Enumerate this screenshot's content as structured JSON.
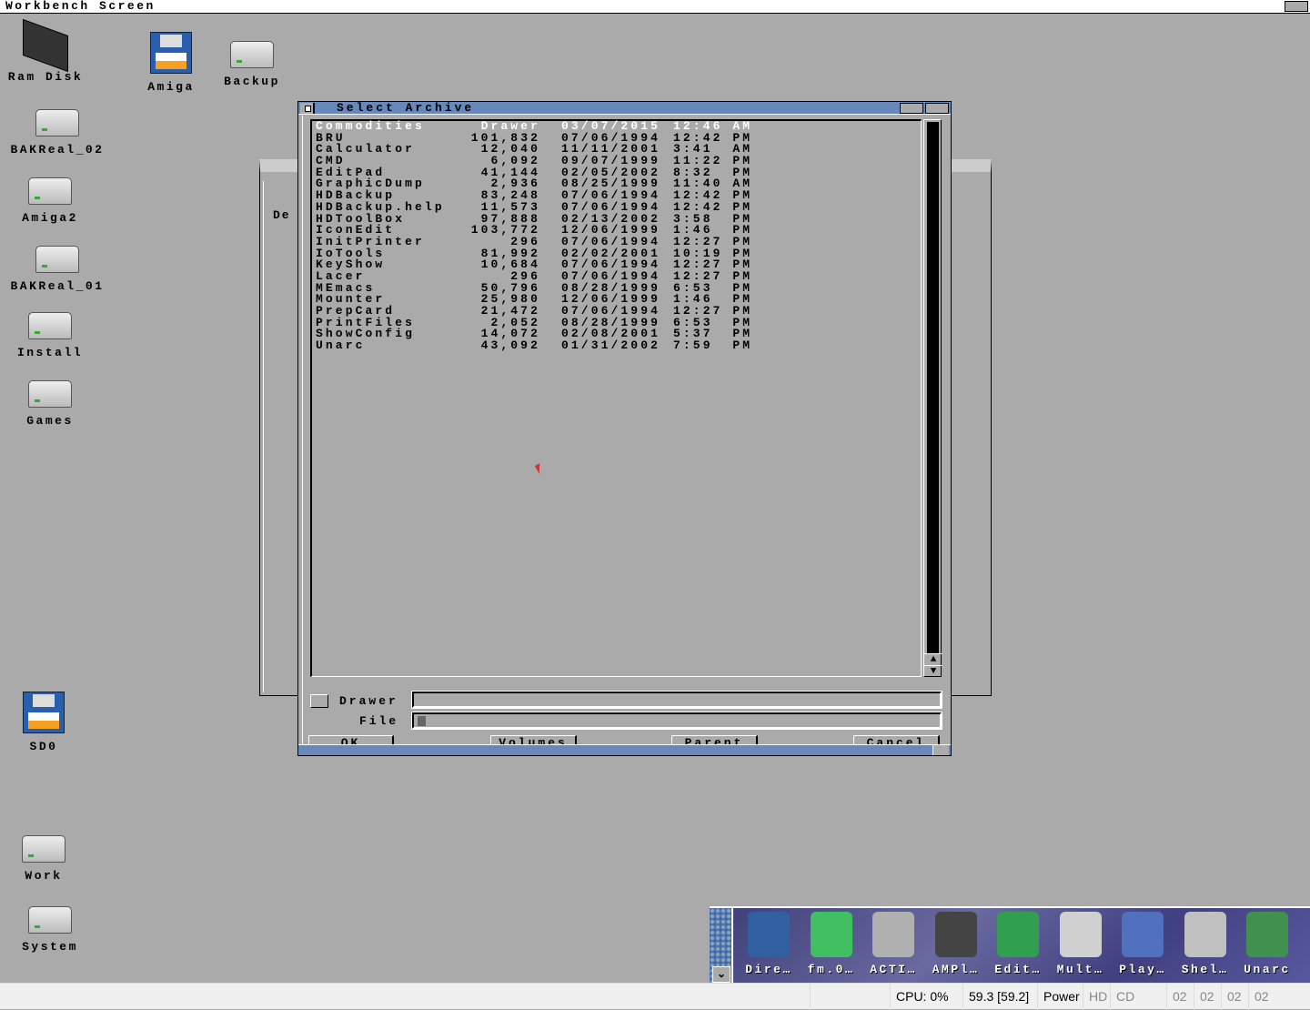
{
  "screen": {
    "title": "Workbench Screen"
  },
  "desktop_icons": [
    {
      "label": "Ram Disk",
      "icon": "ram-chip-icon"
    },
    {
      "label": "Amiga",
      "icon": "floppy-icon"
    },
    {
      "label": "Backup",
      "icon": "harddisk-icon"
    },
    {
      "label": "BAKReal_02",
      "icon": "harddisk-icon"
    },
    {
      "label": "Amiga2",
      "icon": "harddisk-icon"
    },
    {
      "label": "BAKReal_01",
      "icon": "harddisk-icon"
    },
    {
      "label": "Install",
      "icon": "harddisk-icon"
    },
    {
      "label": "Games",
      "icon": "harddisk-icon"
    },
    {
      "label": "SD0",
      "icon": "floppy-icon"
    },
    {
      "label": "Work",
      "icon": "harddisk-icon"
    },
    {
      "label": "System",
      "icon": "harddisk-icon"
    }
  ],
  "background_window": {
    "partial_label": "De"
  },
  "dialog": {
    "title": "Select Archive",
    "files": [
      {
        "name": "Commodities",
        "size": "Drawer",
        "date": "03/07/2015",
        "time": "12:46 AM",
        "selected": true
      },
      {
        "name": "BRU",
        "size": "101,832",
        "date": "07/06/1994",
        "time": "12:42 PM"
      },
      {
        "name": "Calculator",
        "size": "12,040",
        "date": "11/11/2001",
        "time": "3:41  AM"
      },
      {
        "name": "CMD",
        "size": "6,092",
        "date": "09/07/1999",
        "time": "11:22 PM"
      },
      {
        "name": "EditPad",
        "size": "41,144",
        "date": "02/05/2002",
        "time": "8:32  PM"
      },
      {
        "name": "GraphicDump",
        "size": "2,936",
        "date": "08/25/1999",
        "time": "11:40 AM"
      },
      {
        "name": "HDBackup",
        "size": "83,248",
        "date": "07/06/1994",
        "time": "12:42 PM"
      },
      {
        "name": "HDBackup.help",
        "size": "11,573",
        "date": "07/06/1994",
        "time": "12:42 PM"
      },
      {
        "name": "HDToolBox",
        "size": "97,888",
        "date": "02/13/2002",
        "time": "3:58  PM"
      },
      {
        "name": "IconEdit",
        "size": "103,772",
        "date": "12/06/1999",
        "time": "1:46  PM"
      },
      {
        "name": "InitPrinter",
        "size": "296",
        "date": "07/06/1994",
        "time": "12:27 PM"
      },
      {
        "name": "IoTools",
        "size": "81,992",
        "date": "02/02/2001",
        "time": "10:19 PM"
      },
      {
        "name": "KeyShow",
        "size": "10,684",
        "date": "07/06/1994",
        "time": "12:27 PM"
      },
      {
        "name": "Lacer",
        "size": "296",
        "date": "07/06/1994",
        "time": "12:27 PM"
      },
      {
        "name": "MEmacs",
        "size": "50,796",
        "date": "08/28/1999",
        "time": "6:53  PM"
      },
      {
        "name": "Mounter",
        "size": "25,980",
        "date": "12/06/1999",
        "time": "1:46  PM"
      },
      {
        "name": "PrepCard",
        "size": "21,472",
        "date": "07/06/1994",
        "time": "12:27 PM"
      },
      {
        "name": "PrintFiles",
        "size": "2,052",
        "date": "08/28/1999",
        "time": "6:53  PM"
      },
      {
        "name": "ShowConfig",
        "size": "14,072",
        "date": "02/08/2001",
        "time": "5:37  PM"
      },
      {
        "name": "Unarc",
        "size": "43,092",
        "date": "01/31/2002",
        "time": "7:59  PM"
      }
    ],
    "drawer_label": "Drawer",
    "drawer_value": "",
    "file_label": "File",
    "file_value": "",
    "buttons": {
      "ok": "OK",
      "volumes": "Volumes",
      "parent": "Parent",
      "cancel": "Cancel"
    },
    "title_color": "#6688bb"
  },
  "dock": {
    "items": [
      {
        "label": "Dire…",
        "icon": "directory-opus-icon",
        "color": "#3060a0"
      },
      {
        "label": "fm.0…",
        "icon": "file-manager-icon",
        "color": "#40c060"
      },
      {
        "label": "ACTI…",
        "icon": "film-icon",
        "color": "#b0b0b0"
      },
      {
        "label": "AMPl…",
        "icon": "speaker-icon",
        "color": "#444444"
      },
      {
        "label": "Edit…",
        "icon": "notepad-icon",
        "color": "#30a050"
      },
      {
        "label": "Mult…",
        "icon": "magnifier-icon",
        "color": "#d0d0d0"
      },
      {
        "label": "Play…",
        "icon": "cd-player-icon",
        "color": "#5070c0"
      },
      {
        "label": "Shel…",
        "icon": "shell-icon",
        "color": "#c0c0c0"
      },
      {
        "label": "Unarc",
        "icon": "cube-icon",
        "color": "#409050"
      }
    ]
  },
  "statusbar": {
    "cpu": "CPU: 0%",
    "fps": "59.3 [59.2]",
    "power": "Power",
    "hd": "HD",
    "cd": "CD",
    "drives": [
      "02",
      "02",
      "02",
      "02"
    ]
  }
}
